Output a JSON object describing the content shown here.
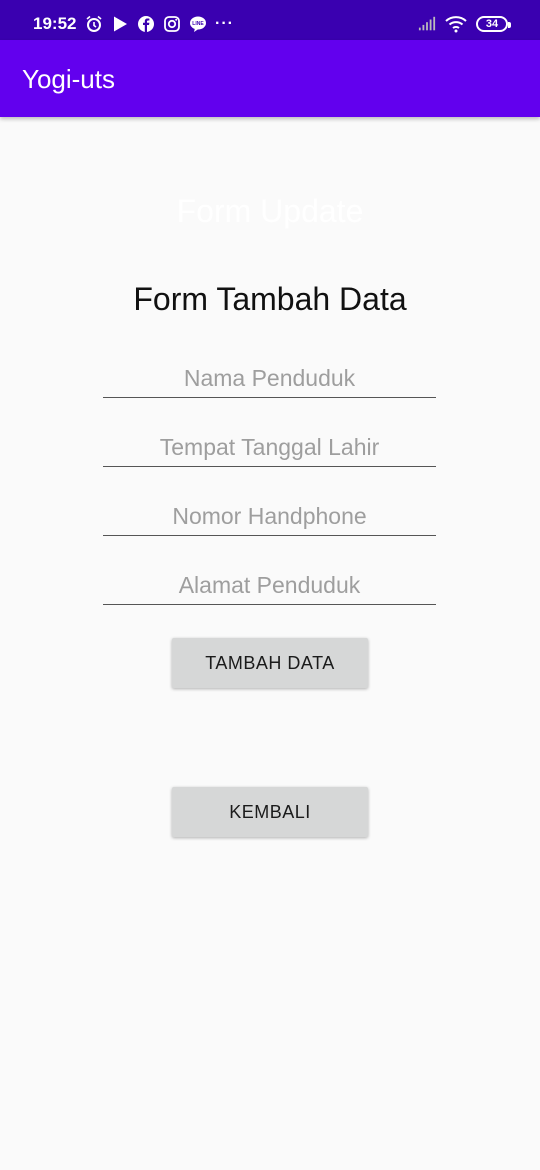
{
  "status_bar": {
    "time": "19:52",
    "more": "···",
    "battery": "34",
    "icons": [
      "alarm-icon",
      "play-store-icon",
      "facebook-icon",
      "instagram-icon",
      "line-icon",
      "signal-icon",
      "wifi-icon",
      "battery-icon"
    ]
  },
  "app_bar": {
    "title": "Yogi-uts",
    "color": "#6200ee"
  },
  "form": {
    "hidden_title": "Form Update",
    "title": "Form Tambah Data",
    "fields": [
      {
        "placeholder": "Nama Penduduk",
        "value": ""
      },
      {
        "placeholder": "Tempat Tanggal Lahir",
        "value": ""
      },
      {
        "placeholder": "Nomor Handphone",
        "value": ""
      },
      {
        "placeholder": "Alamat Penduduk",
        "value": ""
      }
    ],
    "submit_label": "TAMBAH DATA",
    "back_label": "KEMBALI"
  }
}
